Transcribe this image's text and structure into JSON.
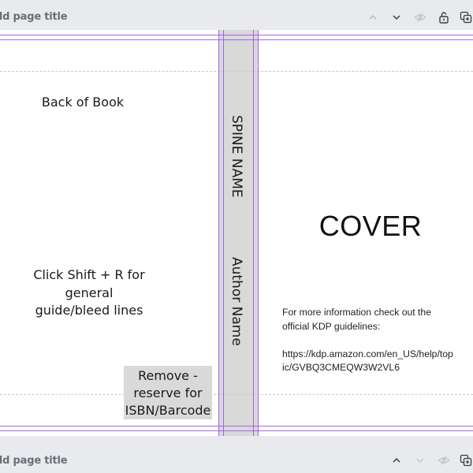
{
  "header_top": {
    "page_title_placeholder": "dd page title",
    "tools": [
      "chevron-up",
      "chevron-down",
      "eye-hidden",
      "lock-open",
      "duplicate-page"
    ]
  },
  "canvas": {
    "back_title": "Back of Book",
    "shift_note": [
      "Click Shift + R for",
      "general",
      "guide/bleed lines"
    ],
    "barcode_note": [
      "Remove -",
      "reserve for",
      "ISBN/Barcode"
    ],
    "spine_name": "SPINE NAME",
    "author_name": "Author Name",
    "cover_title": "COVER",
    "info_lines": [
      "For more information check out the",
      "official KDP guidelines:"
    ],
    "info_url": [
      "https://kdp.amazon.com/en_US/help/top",
      "ic/GVBQ3CMEQW3W2VL6"
    ],
    "colors": {
      "guide": "#9b59e0",
      "spine": "#d9d9d9",
      "background": "#e9eaee"
    }
  },
  "header_bottom": {
    "page_title_placeholder": "dd page title",
    "tools": [
      "chevron-up",
      "chevron-down",
      "eye-hidden",
      "duplicate-page"
    ]
  }
}
